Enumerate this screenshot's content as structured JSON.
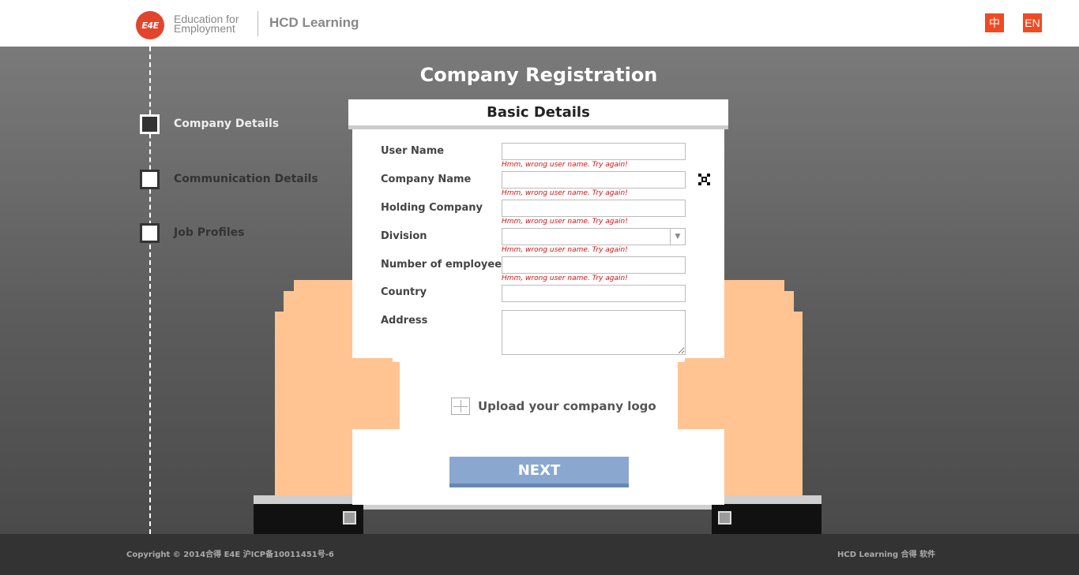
{
  "header": {
    "logo_mark": "E4E",
    "logo_text": "Education for Employment",
    "brand": "HCD Learning",
    "languages": [
      "中",
      "EN"
    ]
  },
  "page_title": "Company Registration",
  "steps": [
    {
      "label": "Company Details",
      "active": true
    },
    {
      "label": "Communication Details",
      "active": false
    },
    {
      "label": "Job Profiles",
      "active": false
    }
  ],
  "card": {
    "title": "Basic Details",
    "fields": [
      {
        "label": "User Name",
        "value": "",
        "error": "Hmm, wrong user name. Try again!"
      },
      {
        "label": "Company Name",
        "value": "",
        "error": "Hmm, wrong user name. Try again!"
      },
      {
        "label": "Holding Company",
        "value": "",
        "error": "Hmm, wrong user name. Try again!"
      },
      {
        "label": "Division",
        "value": "",
        "error": "Hmm, wrong user name. Try again!"
      },
      {
        "label": "Number of employees",
        "value": "",
        "error": "Hmm, wrong user name. Try again!"
      },
      {
        "label": "Country",
        "value": ""
      },
      {
        "label": "Address",
        "value": ""
      }
    ],
    "upload_label": "Upload your company logo",
    "next_label": "NEXT"
  },
  "footer": {
    "copyright": "Copyright © 2014合得 E4E 沪ICP备10011451号-6",
    "brand": "HCD Learning 合得 软件"
  },
  "colors": {
    "accent": "#f04a23",
    "button": "#8aa8cf",
    "error": "#d31010",
    "skin": "#ffc492"
  }
}
